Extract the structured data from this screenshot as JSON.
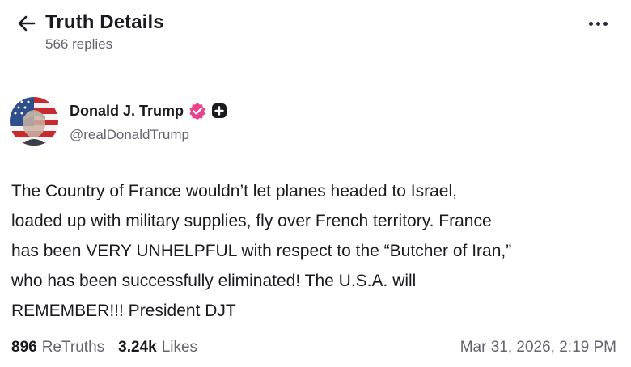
{
  "header": {
    "title": "Truth Details",
    "subtitle": "566 replies",
    "back_icon": "arrow-left-icon",
    "more_icon": "more-horizontal-icon"
  },
  "author": {
    "name": "Donald J. Trump",
    "handle": "@realDonaldTrump",
    "verified_icon": "verified-badge-icon",
    "follow_icon": "plus-square-icon",
    "verified_color": "#e8448d"
  },
  "post": {
    "lines": [
      "The Country of France wouldn’t let planes headed to Israel,",
      "loaded up with military supplies, fly over French territory. France",
      "has been VERY UNHELPFUL with respect to the “Butcher of Iran,”",
      "who has been successfully eliminated! The U.S.A. will",
      "REMEMBER!!! President DJT"
    ]
  },
  "stats": {
    "retruths_count": "896",
    "retruths_label": "ReTruths",
    "likes_count": "3.24k",
    "likes_label": "Likes",
    "timestamp": "Mar 31, 2026, 2:19 PM"
  }
}
